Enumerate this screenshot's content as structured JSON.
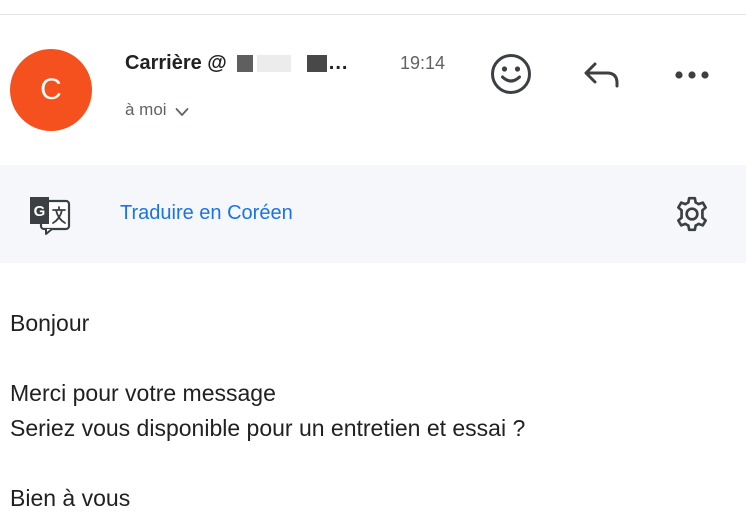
{
  "header": {
    "avatar_letter": "C",
    "sender_name": "Carrière @",
    "sender_truncation": "...",
    "time": "19:14",
    "recipient_label": "à moi",
    "icons": {
      "recipient_toggle": "chevron-down-icon",
      "emoji": "emoji-icon",
      "reply": "reply-icon",
      "more": "more-icon"
    }
  },
  "translate": {
    "link_label": "Traduire en Coréen",
    "icons": {
      "translate": "translate-icon",
      "settings": "gear-icon"
    }
  },
  "message": {
    "greeting": "Bonjour",
    "line1": "Merci pour votre message",
    "line2": "Seriez vous disponible pour un entretien et essai ?",
    "closing": "Bien à vous"
  },
  "colors": {
    "avatar": "#f4511e",
    "link": "#1a73e8",
    "translate_bar": "#f5f7fa",
    "text": "#202124",
    "secondary_text": "#5f6368"
  }
}
